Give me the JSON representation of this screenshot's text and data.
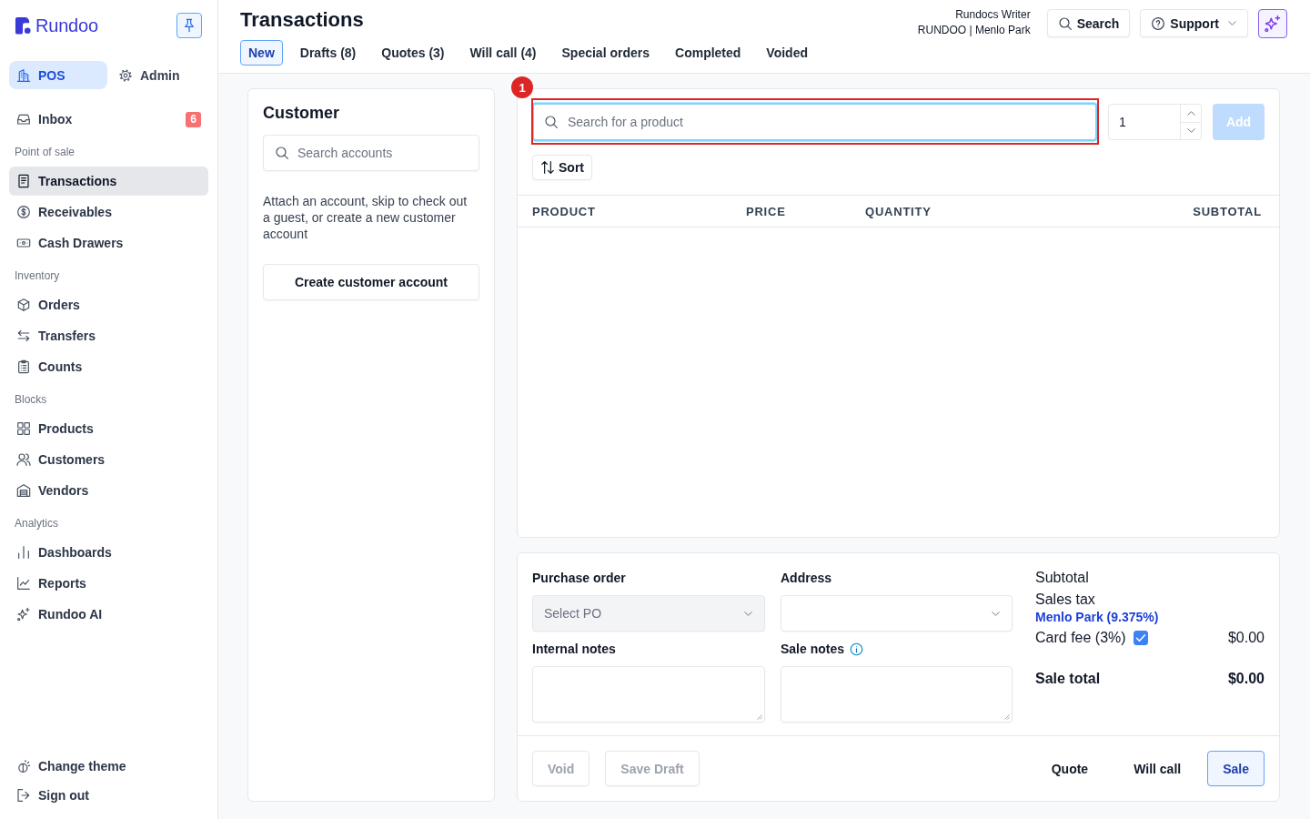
{
  "sidebar": {
    "logo": "Rundoo",
    "modes": [
      {
        "label": "POS",
        "selected": true
      },
      {
        "label": "Admin",
        "selected": false
      }
    ],
    "nav": [
      {
        "items": [
          {
            "label": "Inbox",
            "badge": "6",
            "selected": false
          }
        ]
      },
      {
        "title": "Point of sale",
        "items": [
          {
            "label": "Transactions",
            "selected": true
          },
          {
            "label": "Receivables",
            "selected": false
          },
          {
            "label": "Cash Drawers",
            "selected": false
          }
        ]
      },
      {
        "title": "Inventory",
        "items": [
          {
            "label": "Orders",
            "selected": false
          },
          {
            "label": "Transfers",
            "selected": false
          },
          {
            "label": "Counts",
            "selected": false
          }
        ]
      },
      {
        "title": "Blocks",
        "items": [
          {
            "label": "Products",
            "selected": false
          },
          {
            "label": "Customers",
            "selected": false
          },
          {
            "label": "Vendors",
            "selected": false
          }
        ]
      },
      {
        "title": "Analytics",
        "items": [
          {
            "label": "Dashboards",
            "selected": false
          },
          {
            "label": "Reports",
            "selected": false
          },
          {
            "label": "Rundoo AI",
            "selected": false
          }
        ]
      }
    ],
    "footer": [
      {
        "label": "Change theme"
      },
      {
        "label": "Sign out"
      }
    ]
  },
  "header": {
    "title": "Transactions",
    "tabs": [
      {
        "label": "New",
        "selected": true
      },
      {
        "label": "Drafts (8)",
        "selected": false
      },
      {
        "label": "Quotes (3)",
        "selected": false
      },
      {
        "label": "Will call (4)",
        "selected": false
      },
      {
        "label": "Special orders",
        "selected": false
      },
      {
        "label": "Completed",
        "selected": false
      },
      {
        "label": "Voided",
        "selected": false
      }
    ],
    "user": {
      "name": "Rundocs Writer",
      "store": "RUNDOO | Menlo Park"
    },
    "buttons": [
      {
        "label": "Search",
        "kind": "button"
      },
      {
        "label": "Support",
        "kind": "dropdown"
      }
    ]
  },
  "customer": {
    "title": "Customer",
    "search": {
      "placeholder": "Search accounts"
    },
    "hint": "Attach an account, skip to check out a guest, or create a new customer account",
    "create_button": "Create customer account"
  },
  "products": {
    "search": {
      "placeholder": "Search for a product",
      "focused": true,
      "annotation": "1"
    },
    "quantity": {
      "value": "1"
    },
    "add_button": {
      "label": "Add",
      "disabled": true
    },
    "sort_button": "Sort",
    "table": {
      "columns": [
        "PRODUCT",
        "PRICE",
        "QUANTITY",
        "SUBTOTAL"
      ]
    }
  },
  "order": {
    "purchase_order": {
      "label": "Purchase order",
      "placeholder": "Select PO",
      "disabled": true
    },
    "address": {
      "label": "Address"
    },
    "internal_notes": {
      "label": "Internal notes"
    },
    "sale_notes": {
      "label": "Sale notes"
    }
  },
  "totals": {
    "subtotal": {
      "label": "Subtotal"
    },
    "sales_tax": {
      "label": "Sales tax",
      "location": "Menlo Park (9.375%)"
    },
    "card_fee": {
      "label": "Card fee (3%)",
      "checked": true,
      "amount": "$0.00"
    },
    "sale_total": {
      "label": "Sale total",
      "amount": "$0.00"
    }
  },
  "actions": {
    "left": [
      {
        "label": "Void",
        "disabled": true
      },
      {
        "label": "Save Draft",
        "disabled": true
      }
    ],
    "right": [
      {
        "label": "Quote",
        "kind": "text"
      },
      {
        "label": "Will call",
        "kind": "text"
      },
      {
        "label": "Sale",
        "kind": "primary"
      }
    ]
  }
}
